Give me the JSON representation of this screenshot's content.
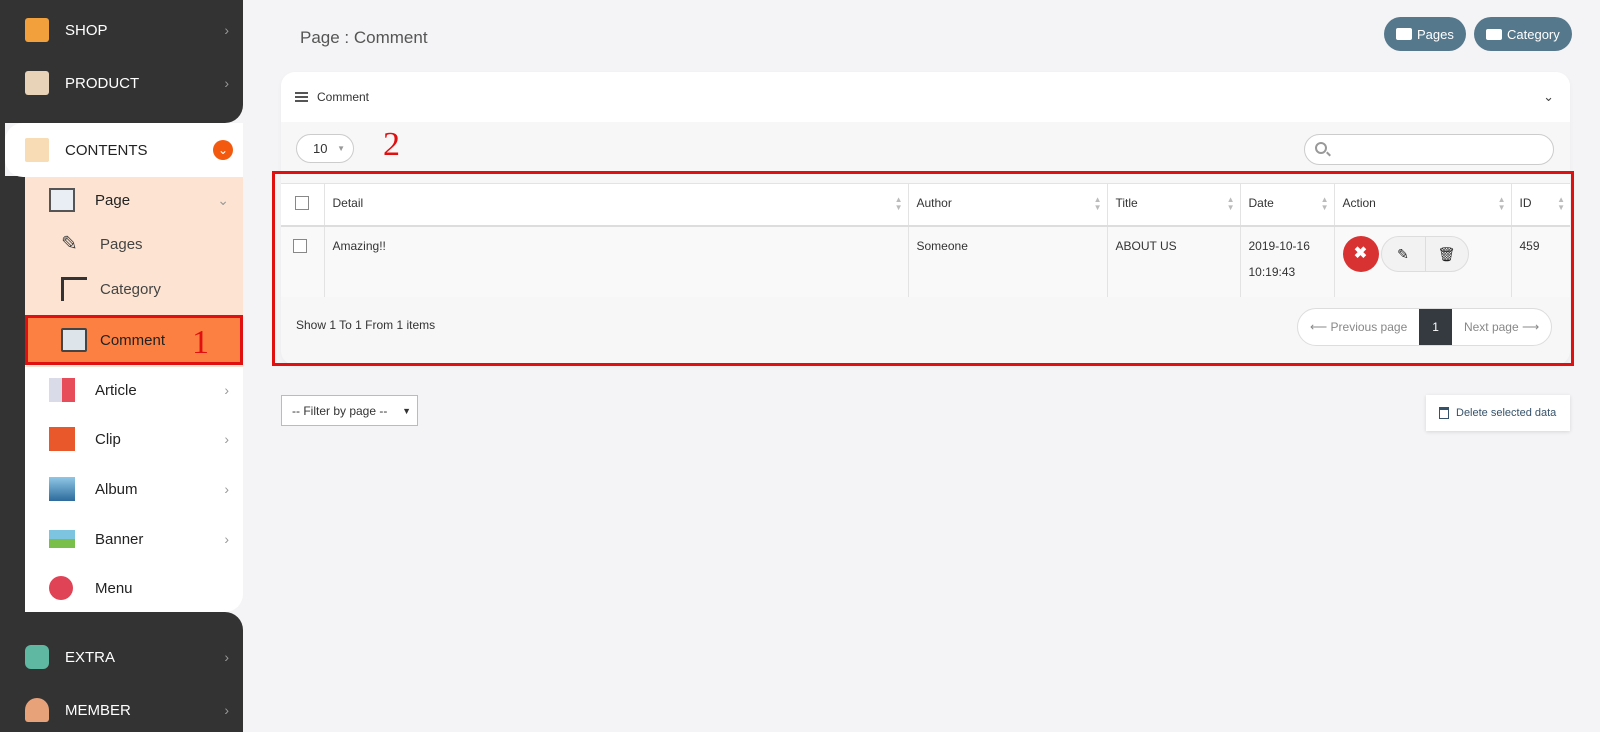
{
  "sidebar": {
    "shop": {
      "label": "SHOP"
    },
    "product": {
      "label": "PRODUCT"
    },
    "contents": {
      "label": "CONTENTS"
    },
    "page": {
      "label": "Page"
    },
    "pages": {
      "label": "Pages"
    },
    "category": {
      "label": "Category"
    },
    "comment": {
      "label": "Comment"
    },
    "article": {
      "label": "Article"
    },
    "clip": {
      "label": "Clip"
    },
    "album": {
      "label": "Album"
    },
    "banner": {
      "label": "Banner"
    },
    "menu": {
      "label": "Menu"
    },
    "extra": {
      "label": "EXTRA"
    },
    "member": {
      "label": "MEMBER"
    }
  },
  "annotations": {
    "one": "1",
    "two": "2"
  },
  "header": {
    "title": "Page : Comment",
    "pages_btn": "Pages",
    "category_btn": "Category"
  },
  "card": {
    "title": "Comment",
    "length": "10",
    "search_placeholder": ""
  },
  "table": {
    "columns": [
      "Detail",
      "Author",
      "Title",
      "Date",
      "Action",
      "ID"
    ],
    "rows": [
      {
        "detail": "Amazing!!",
        "author": "Someone",
        "title": "ABOUT US",
        "date": "2019-10-16",
        "time": "10:19:43",
        "id": "459"
      }
    ]
  },
  "footer": {
    "info": "Show 1 To 1 From 1 items",
    "prev": "⟵ Previous page",
    "page": "1",
    "next": "Next page ⟶"
  },
  "filter": {
    "label": "-- Filter by page --"
  },
  "delete": {
    "label": "Delete selected data"
  },
  "colors": {
    "accent": "#f35a10",
    "active": "#fb8042",
    "annotation": "#e01010",
    "pill": "#56788c"
  }
}
